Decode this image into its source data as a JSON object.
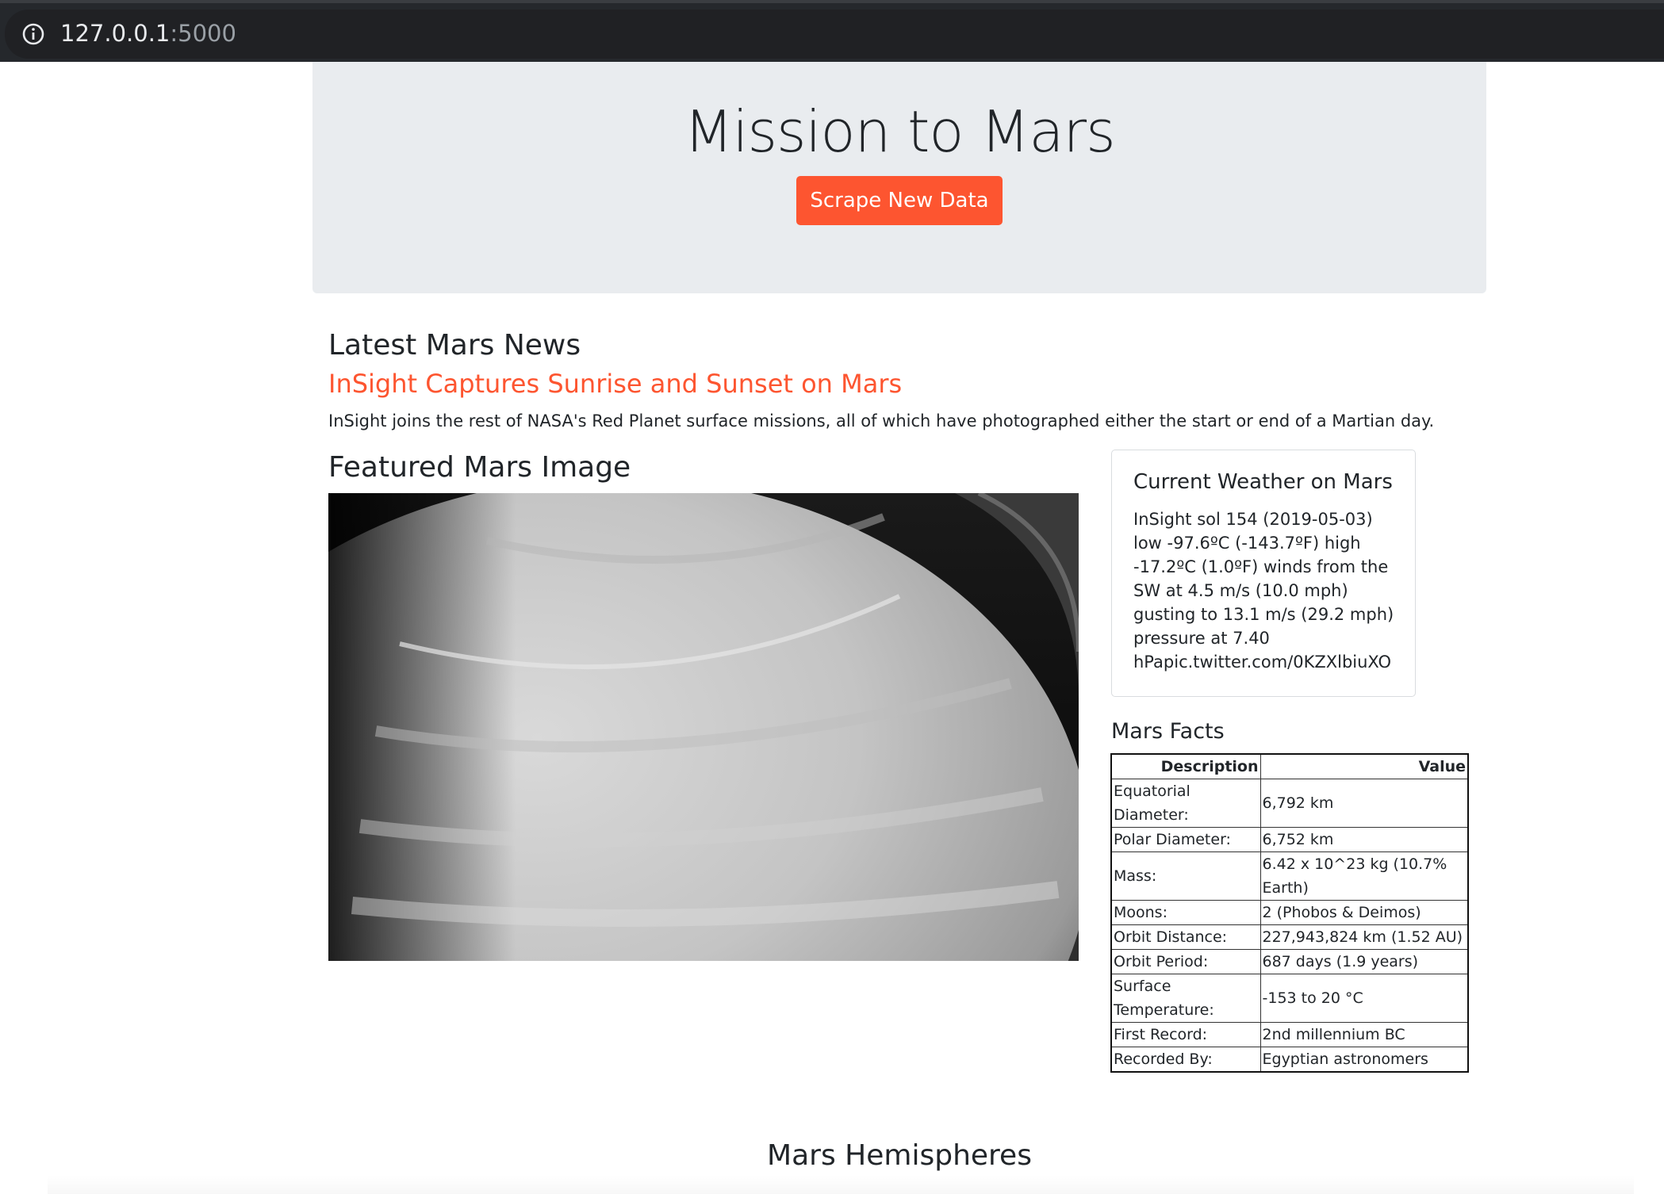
{
  "browser": {
    "url_host": "127.0.0.1",
    "url_port": ":5000",
    "icon": "info-icon"
  },
  "header": {
    "title": "Mission to Mars",
    "scrape_button": "Scrape New Data",
    "accent_color": "#fd5530"
  },
  "news": {
    "heading": "Latest Mars News",
    "title": "InSight Captures Sunrise and Sunset on Mars",
    "paragraph": "InSight joins the rest of NASA's Red Planet surface missions, all of which have photographed either the start or end of a Martian day."
  },
  "featured_image": {
    "heading": "Featured Mars Image"
  },
  "weather": {
    "heading": "Current Weather on Mars",
    "lines": [
      "InSight sol 154 (2019-05-03)",
      "low -97.6ºC (-143.7ºF) high",
      "-17.2ºC (1.0ºF) winds from the",
      "SW at 4.5 m/s (10.0 mph)",
      "gusting to 13.1 m/s (29.2 mph)",
      "pressure at 7.40",
      "hPapic.twitter.com/0KZXlbiuXO"
    ]
  },
  "facts": {
    "heading": "Mars Facts",
    "columns": [
      "Description",
      "Value"
    ],
    "rows": [
      {
        "d": "Equatorial Diameter:",
        "v": "6,792 km"
      },
      {
        "d": "Polar Diameter:",
        "v": "6,752 km"
      },
      {
        "d": "Mass:",
        "v": "6.42 x 10^23 kg (10.7% Earth)"
      },
      {
        "d": "Moons:",
        "v": "2 (Phobos & Deimos)"
      },
      {
        "d": "Orbit Distance:",
        "v": "227,943,824 km (1.52 AU)"
      },
      {
        "d": "Orbit Period:",
        "v": "687 days (1.9 years)"
      },
      {
        "d": "Surface Temperature:",
        "v": "-153 to 20 °C"
      },
      {
        "d": "First Record:",
        "v": "2nd millennium BC"
      },
      {
        "d": "Recorded By:",
        "v": "Egyptian astronomers"
      }
    ]
  },
  "hemispheres": {
    "heading": "Mars Hemispheres"
  }
}
